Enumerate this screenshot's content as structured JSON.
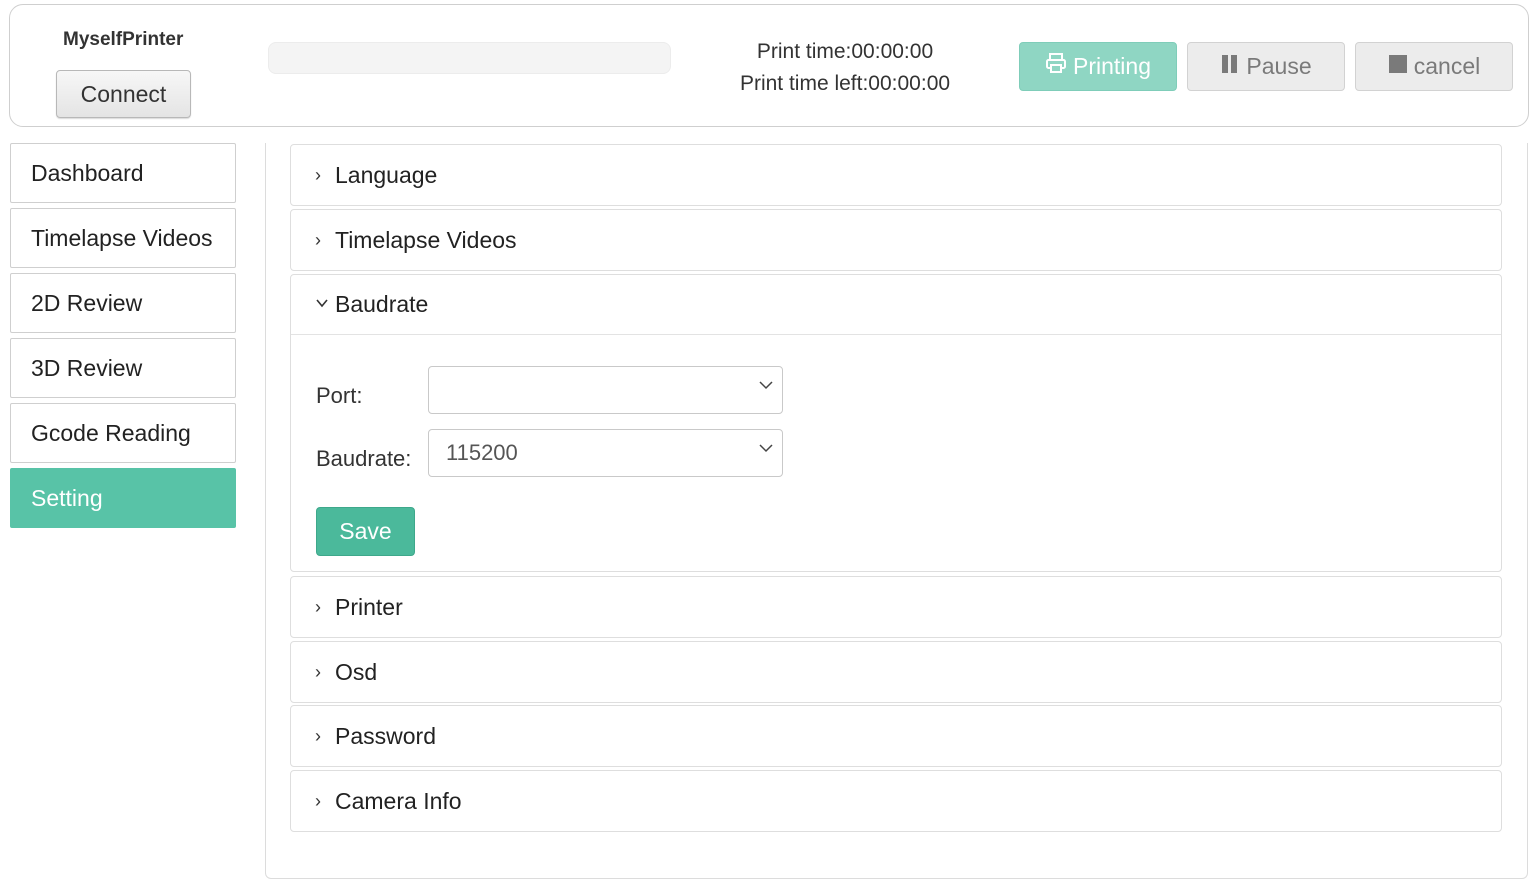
{
  "header": {
    "app_title": "MyselfPrinter",
    "connect_label": "Connect",
    "progress_percent": 0,
    "print_time": "Print time:00:00:00",
    "print_time_left": "Print time left:00:00:00",
    "printing_label": "Printing",
    "pause_label": "Pause",
    "cancel_label": "cancel",
    "printing_icon": "printer-icon",
    "pause_icon": "pause-icon",
    "cancel_icon": "stop-icon"
  },
  "sidebar": {
    "items": [
      {
        "label": "Dashboard",
        "active": false
      },
      {
        "label": "Timelapse Videos",
        "active": false
      },
      {
        "label": "2D Review",
        "active": false
      },
      {
        "label": "3D Review",
        "active": false
      },
      {
        "label": "Gcode Reading",
        "active": false
      },
      {
        "label": "Setting",
        "active": true
      }
    ]
  },
  "settings": {
    "sections": [
      {
        "label": "Language",
        "expanded": false
      },
      {
        "label": "Timelapse Videos",
        "expanded": false
      },
      {
        "label": "Baudrate",
        "expanded": true
      },
      {
        "label": "Printer",
        "expanded": false
      },
      {
        "label": "Osd",
        "expanded": false
      },
      {
        "label": "Password",
        "expanded": false
      },
      {
        "label": "Camera Info",
        "expanded": false
      }
    ],
    "baudrate_form": {
      "port_label": "Port:",
      "port_value": "",
      "baudrate_label": "Baudrate:",
      "baudrate_value": "115200",
      "save_label": "Save"
    }
  },
  "colors": {
    "accent": "#58c3a7",
    "save_button": "#4bb99b",
    "printing_button": "#8fd6c3",
    "disabled_button": "#ececec"
  }
}
